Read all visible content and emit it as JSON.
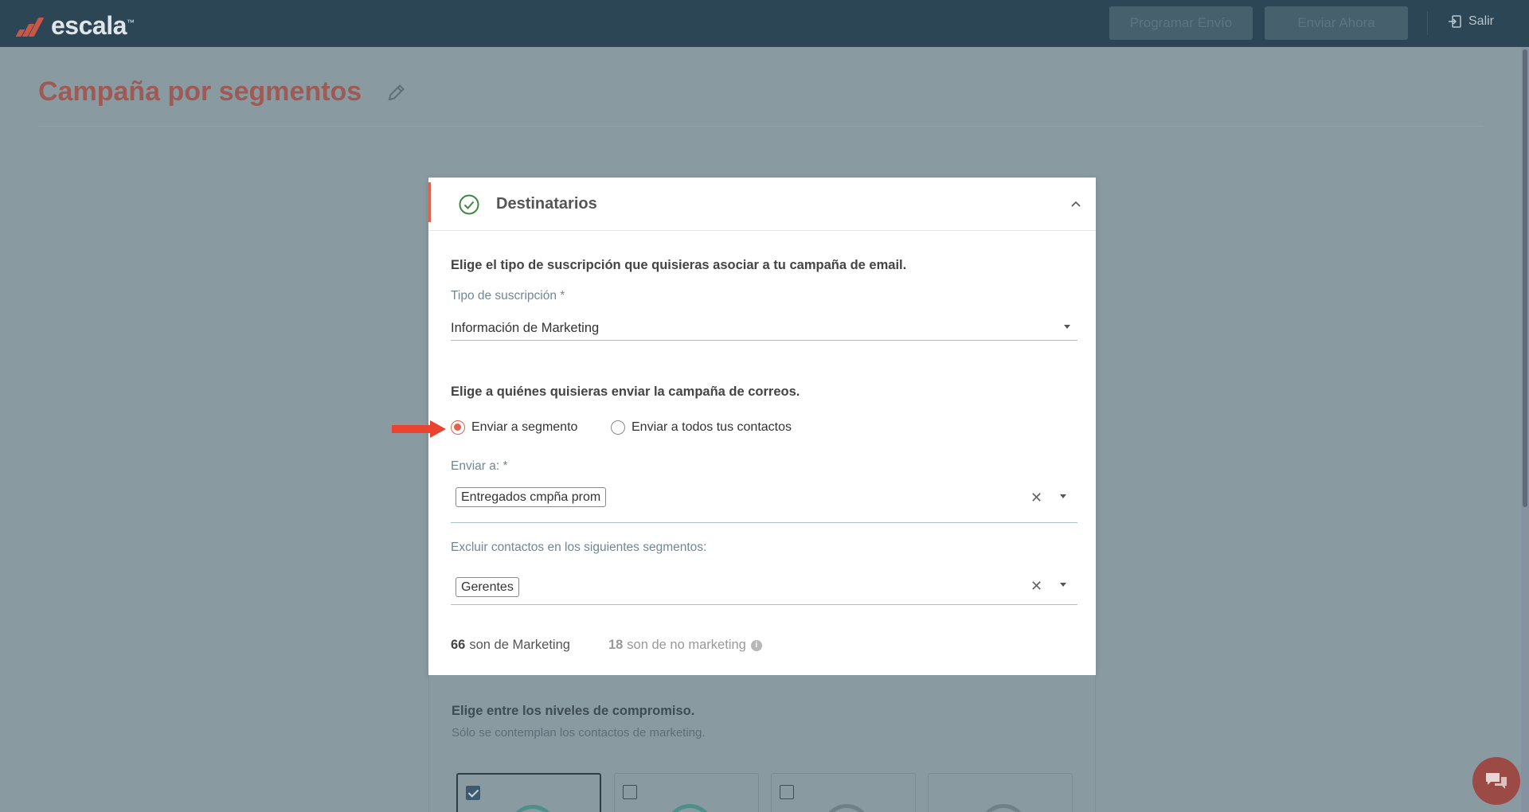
{
  "header": {
    "logo_text": "escala",
    "logo_tm": "™",
    "schedule_button": "Programar Envío",
    "send_now_button": "Enviar Ahora",
    "logout_label": "Salir"
  },
  "page": {
    "title": "Campaña por segmentos"
  },
  "card": {
    "title": "Destinatarios",
    "subscription_question": "Elige el tipo de suscripción que quisieras asociar a tu campaña de email.",
    "subscription_label": "Tipo de suscripción *",
    "subscription_value": "Información de Marketing",
    "recipients_question": "Elige a quiénes quisieras enviar la campaña de correos.",
    "radio_segment": "Enviar a segmento",
    "radio_all": "Enviar a todos tus contactos",
    "radio_selected": "segment",
    "send_to_label": "Enviar a: *",
    "send_to_chip": "Entregados cmpña prom",
    "exclude_label": "Excluir contactos en los siguientes segmentos:",
    "exclude_chip": "Gerentes",
    "stats": {
      "marketing_count": "66",
      "marketing_text": "son de Marketing",
      "non_marketing_count": "18",
      "non_marketing_text": "son de no marketing"
    }
  },
  "engagement": {
    "question": "Elige entre los niveles de compromiso.",
    "note": "Sólo se contemplan los contactos de marketing.",
    "levels_checked": [
      true,
      false,
      false,
      false
    ]
  },
  "colors": {
    "header_bg": "#2c4655",
    "brand_red": "#e0624d",
    "title_red": "#9e5a55",
    "overlay_bg": "#8a9aa1"
  },
  "icons": {
    "edit": "pencil-icon",
    "check": "check-circle-icon",
    "collapse": "chevron-up-icon",
    "logout": "logout-icon",
    "info": "info-icon",
    "chat": "chat-icon"
  }
}
